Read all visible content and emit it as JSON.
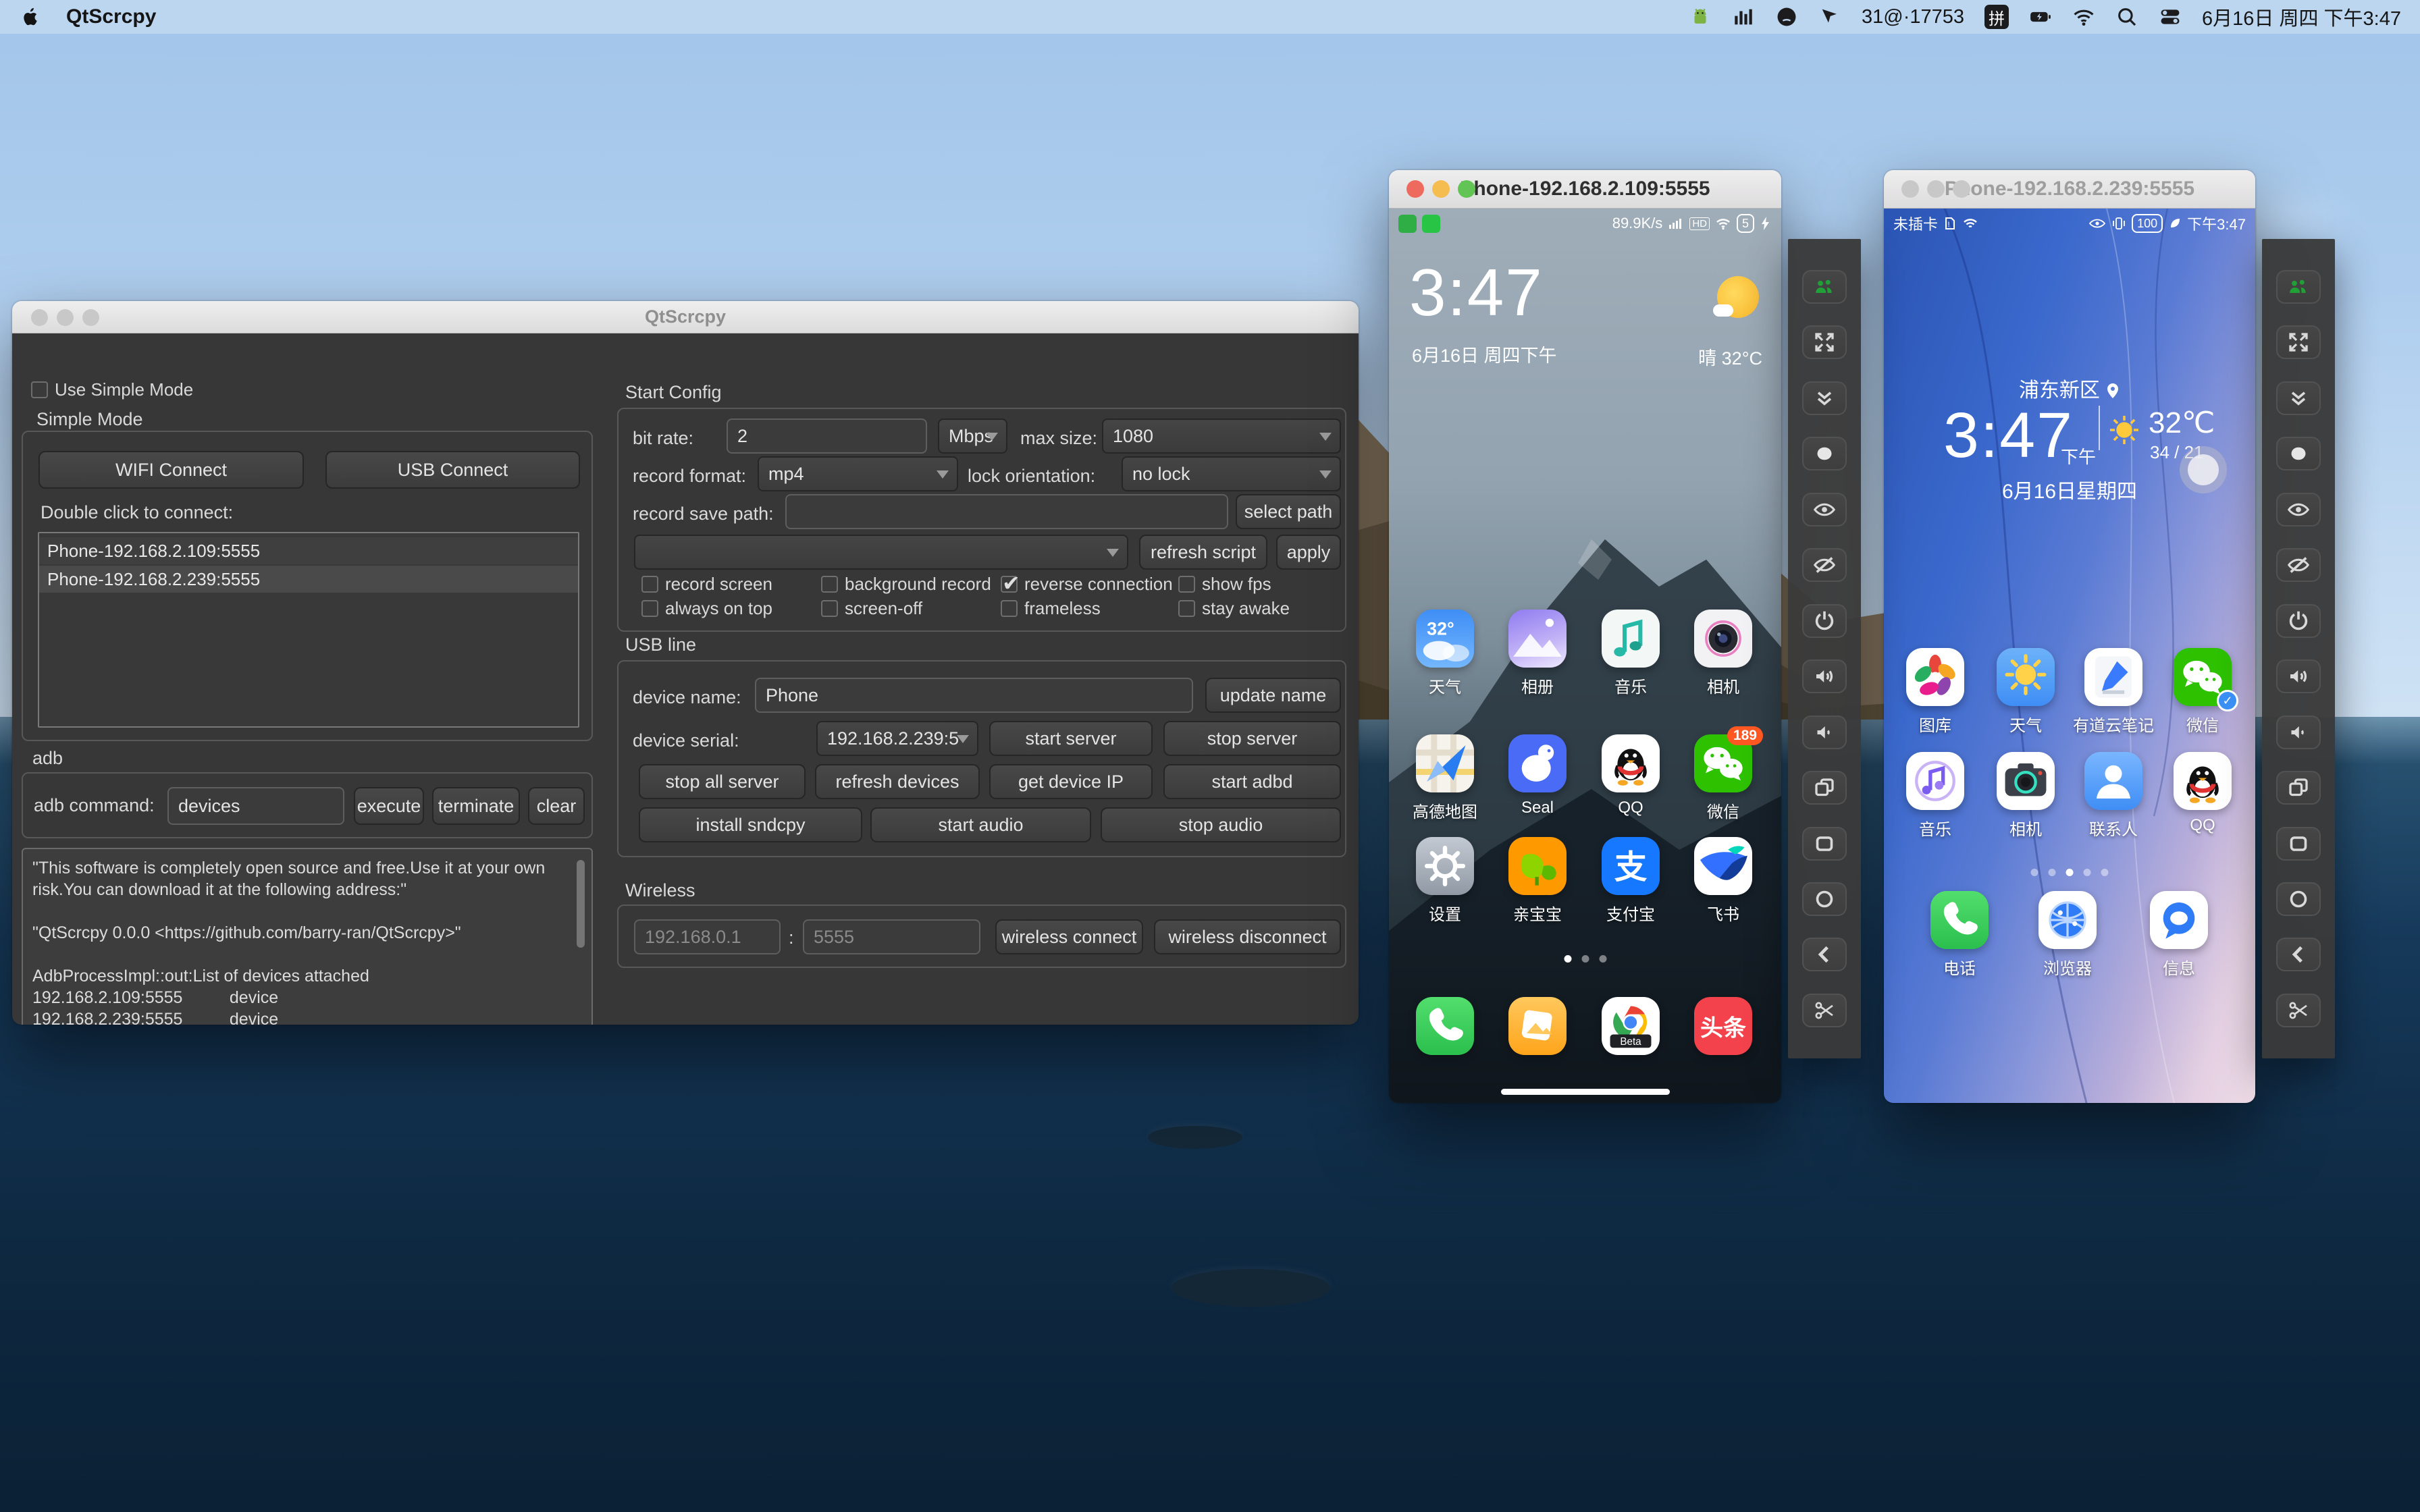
{
  "menu_bar": {
    "app_name": "QtScrcpy",
    "ime_label": "拼",
    "right_items": [
      {
        "type": "icon",
        "name": "android-icon"
      },
      {
        "type": "icon",
        "name": "stats-bars-icon"
      },
      {
        "type": "icon",
        "name": "github-icon"
      },
      {
        "type": "icon",
        "name": "download-flag-icon"
      },
      {
        "type": "text",
        "value": "31@·17753"
      },
      {
        "type": "ime"
      },
      {
        "type": "icon",
        "name": "battery-charging-icon"
      },
      {
        "type": "icon",
        "name": "wifi-icon"
      },
      {
        "type": "icon",
        "name": "search-icon"
      },
      {
        "type": "icon",
        "name": "control-center-icon"
      },
      {
        "type": "text",
        "value": "6月16日 周四 下午3:47"
      }
    ]
  },
  "main_window": {
    "title": "QtScrcpy",
    "use_simple_mode_label": "Use Simple Mode",
    "simple_mode_label": "Simple Mode",
    "wifi_connect": "WIFI Connect",
    "usb_connect": "USB Connect",
    "double_click_label": "Double click to connect:",
    "device_list": [
      "Phone-192.168.2.109:5555",
      "Phone-192.168.2.239:5555"
    ],
    "adb_section_label": "adb",
    "adb_command_label": "adb command:",
    "adb_command_value": "devices",
    "execute_btn": "execute",
    "terminate_btn": "terminate",
    "clear_btn": "clear",
    "log_lines": [
      "\"This software is completely open source and free.Use it at your own risk.You can download it at the following address:\"",
      "",
      "\"QtScrcpy 0.0.0 <https://github.com/barry-ran/QtScrcpy>\"",
      "",
      "AdbProcessImpl::out:List of devices attached",
      "192.168.2.109:5555          device",
      "192.168.2.239:5555          device"
    ],
    "start_config": {
      "section_label": "Start Config",
      "bit_rate_label": "bit rate:",
      "bit_rate_value": "2",
      "bit_rate_unit": "Mbps",
      "max_size_label": "max size:",
      "max_size_value": "1080",
      "record_format_label": "record format:",
      "record_format_value": "mp4",
      "lock_orientation_label": "lock orientation:",
      "lock_orientation_value": "no lock",
      "record_save_path_label": "record save path:",
      "record_save_path_value": "",
      "select_path_btn": "select path",
      "script_value": "",
      "refresh_script_btn": "refresh script",
      "apply_btn": "apply",
      "checkboxes": [
        {
          "label": "record screen",
          "checked": false
        },
        {
          "label": "background record",
          "checked": false
        },
        {
          "label": "reverse connection",
          "checked": true
        },
        {
          "label": "show fps",
          "checked": false
        },
        {
          "label": "always on top",
          "checked": false
        },
        {
          "label": "screen-off",
          "checked": false
        },
        {
          "label": "frameless",
          "checked": false
        },
        {
          "label": "stay awake",
          "checked": false
        }
      ]
    },
    "usb_line": {
      "section_label": "USB line",
      "device_name_label": "device name:",
      "device_name_value": "Phone",
      "update_name_btn": "update name",
      "device_serial_label": "device serial:",
      "device_serial_value": "192.168.2.239:5",
      "server_btns": [
        "start server",
        "stop server"
      ],
      "row3_btns": [
        "stop all server",
        "refresh devices",
        "get device IP",
        "start adbd"
      ],
      "row4_btns": [
        "install sndcpy",
        "start audio",
        "stop audio"
      ]
    },
    "wireless": {
      "section_label": "Wireless",
      "ip_placeholder": "192.168.0.1",
      "separator": ":",
      "port_placeholder": "5555",
      "connect_btn": "wireless connect",
      "disconnect_btn": "wireless disconnect"
    }
  },
  "phone1": {
    "title": "Phone-192.168.2.109:5555",
    "status": {
      "net_speed": "89.9K/s",
      "hd_label": "HD",
      "battery_level": "5"
    },
    "clock": "3:47",
    "date_line": "6月16日 周四下午",
    "weather_text": "晴  32°C",
    "apps": [
      {
        "label": "天气",
        "icon": "weather-miui"
      },
      {
        "label": "相册",
        "icon": "gallery-miui"
      },
      {
        "label": "音乐",
        "icon": "music-miui"
      },
      {
        "label": "相机",
        "icon": "camera-miui"
      },
      {
        "label": "高德地图",
        "icon": "amap"
      },
      {
        "label": "Seal",
        "icon": "seal"
      },
      {
        "label": "QQ",
        "icon": "qq"
      },
      {
        "label": "微信",
        "icon": "wechat",
        "badge": "189"
      },
      {
        "label": "设置",
        "icon": "settings-miui"
      },
      {
        "label": "亲宝宝",
        "icon": "qinbaobao"
      },
      {
        "label": "支付宝",
        "icon": "alipay"
      },
      {
        "label": "飞书",
        "icon": "feishu"
      }
    ],
    "dock": [
      {
        "icon": "phone-call"
      },
      {
        "icon": "gallery-orange"
      },
      {
        "icon": "chrome-beta"
      },
      {
        "icon": "toutiao"
      }
    ],
    "page_dots": 3,
    "active_dot": 0
  },
  "phone2": {
    "title": "Phone-192.168.2.239:5555",
    "status": {
      "left_text": "未插卡",
      "right_time": "下午3:47",
      "battery_level": "100"
    },
    "location": "浦东新区",
    "clock": "3:47",
    "ampm": "下午",
    "temp": "32℃",
    "hi_lo": "34 / 21",
    "date_line": "6月16日星期四",
    "apps": [
      {
        "label": "图库",
        "icon": "hw-gallery"
      },
      {
        "label": "天气",
        "icon": "hw-weather"
      },
      {
        "label": "有道云笔记",
        "icon": "youdao"
      },
      {
        "label": "微信",
        "icon": "wechat",
        "badge_check": true
      },
      {
        "label": "音乐",
        "icon": "hw-music"
      },
      {
        "label": "相机",
        "icon": "hw-camera"
      },
      {
        "label": "联系人",
        "icon": "contacts"
      },
      {
        "label": "QQ",
        "icon": "qq"
      }
    ],
    "dock": [
      {
        "label": "电话",
        "icon": "phone-call"
      },
      {
        "label": "浏览器",
        "icon": "hw-browser"
      },
      {
        "label": "信息",
        "icon": "hw-messages"
      }
    ],
    "page_dots": 5,
    "active_dot": 2
  },
  "toolbar_buttons": [
    "device-group-icon",
    "fullscreen-icon",
    "expand-notification-icon",
    "screenshot-icon",
    "show-screen-icon",
    "hide-screen-icon",
    "power-icon",
    "volume-up-icon",
    "volume-down-icon",
    "app-switch-icon",
    "menu-square-icon",
    "home-circle-icon",
    "back-icon",
    "screen-clip-icon"
  ],
  "icon_texts": {
    "alipay": "支",
    "toutiao": "头条",
    "weather_temp": "32°",
    "chrome_beta": "Beta",
    "wechat_check": "✓"
  },
  "colors": {
    "accent_green": "#22a038",
    "wechat_green": "#2dc100",
    "alipay_blue": "#1678ff",
    "toutiao_red": "#f3424c"
  }
}
